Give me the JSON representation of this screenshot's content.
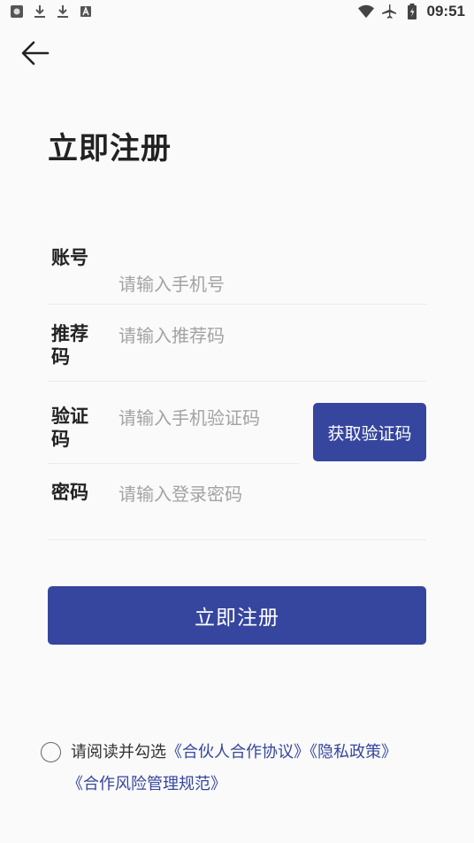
{
  "status_bar": {
    "time": "09:51",
    "left_icons": [
      "app-notification-icon",
      "download-icon",
      "download-icon",
      "keyboard-icon"
    ],
    "right_icons": [
      "wifi-icon",
      "airplane-mode-icon",
      "battery-icon"
    ]
  },
  "header": {
    "back_icon": "back-arrow-icon",
    "title": "立即注册"
  },
  "form": {
    "account": {
      "label": "账号",
      "placeholder": "请输入手机号",
      "value": ""
    },
    "referral": {
      "label": "推荐码",
      "placeholder": "请输入推荐码",
      "value": ""
    },
    "verification": {
      "label": "验证码",
      "placeholder": "请输入手机验证码",
      "value": "",
      "button_label": "获取验证码"
    },
    "password": {
      "label": "密码",
      "placeholder": "请输入登录密码",
      "value": ""
    }
  },
  "submit_label": "立即注册",
  "agreement": {
    "checked": false,
    "prefix": "请阅读并勾选",
    "links": [
      "《合伙人合作协议》",
      "《隐私政策》",
      "《合作风险管理规范》"
    ]
  },
  "colors": {
    "primary": "#36469e",
    "background": "#fafafa",
    "placeholder": "#a3a3a3",
    "divider": "#ebebeb"
  }
}
